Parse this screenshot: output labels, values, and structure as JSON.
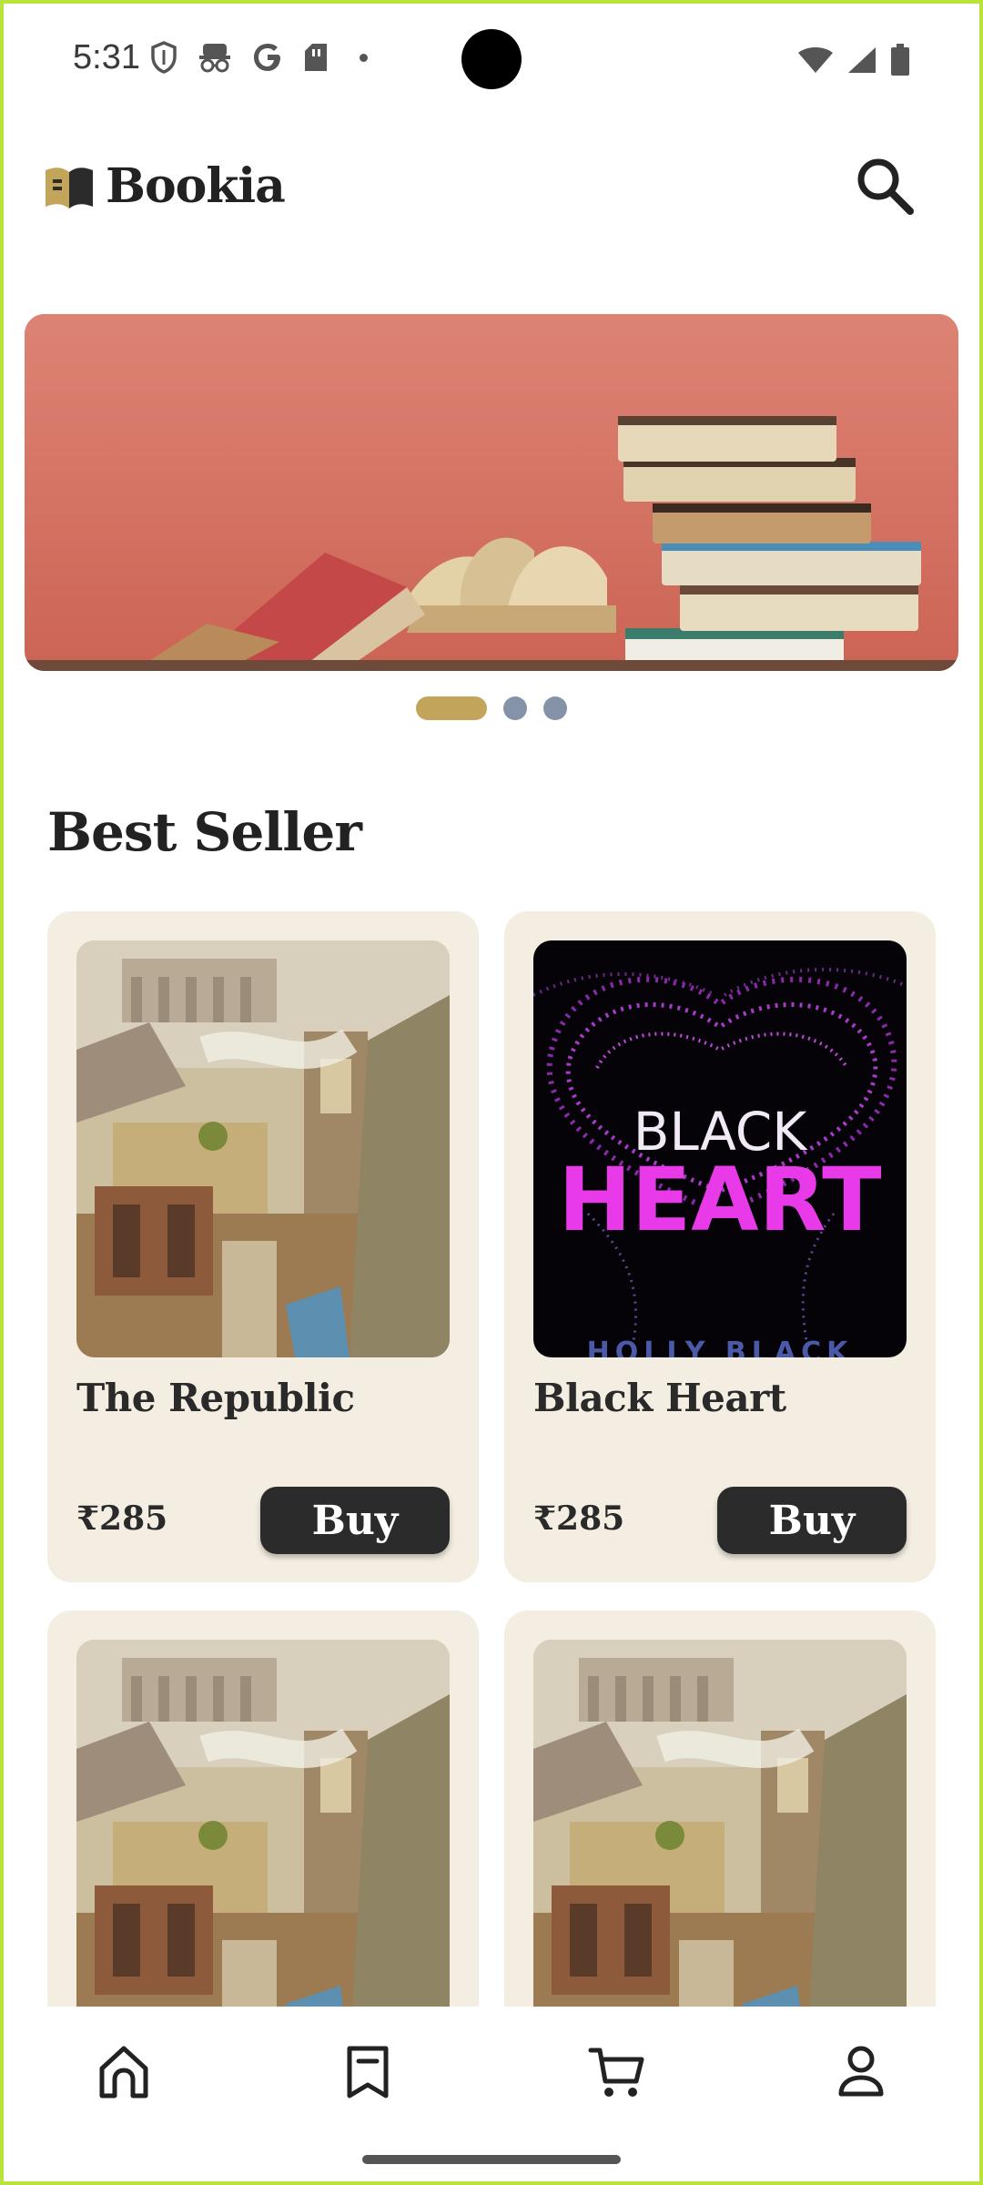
{
  "status_bar": {
    "time": "5:31",
    "left_icons": [
      "shield-icon",
      "incognito-icon",
      "google-icon",
      "sim-card-icon",
      "notification-dot-icon"
    ],
    "right_icons": [
      "wifi-icon",
      "signal-icon",
      "battery-icon"
    ]
  },
  "header": {
    "app_name": "Bookia",
    "logo_icon": "book-logo-icon",
    "search_icon": "search-icon"
  },
  "banner": {
    "image": "stack-of-books-banner",
    "slide_count": 3,
    "active_slide": 1
  },
  "section": {
    "title": "Best Seller"
  },
  "books": [
    {
      "title": "The Republic",
      "price": "₹285",
      "buy_label": "Buy",
      "cover": "republic-cover"
    },
    {
      "title": "Black Heart",
      "price": "₹285",
      "buy_label": "Buy",
      "cover": "black-heart-cover",
      "cover_text_1": "BLACK",
      "cover_text_2": "HEART",
      "cover_author": "HOLLY BLACK"
    },
    {
      "title": "",
      "price": "",
      "buy_label": "",
      "cover": "republic-cover"
    },
    {
      "title": "",
      "price": "",
      "buy_label": "",
      "cover": "republic-cover"
    }
  ],
  "bottom_nav": {
    "items": [
      "home-icon",
      "bookmark-icon",
      "cart-icon",
      "profile-icon"
    ]
  },
  "colors": {
    "accent": "#c2a55a",
    "card_bg": "#f4eee2",
    "button_bg": "#2b2b2b",
    "banner_bg": "#d9776a",
    "dot_inactive": "#8593a8",
    "frame": "#b9e23a"
  }
}
